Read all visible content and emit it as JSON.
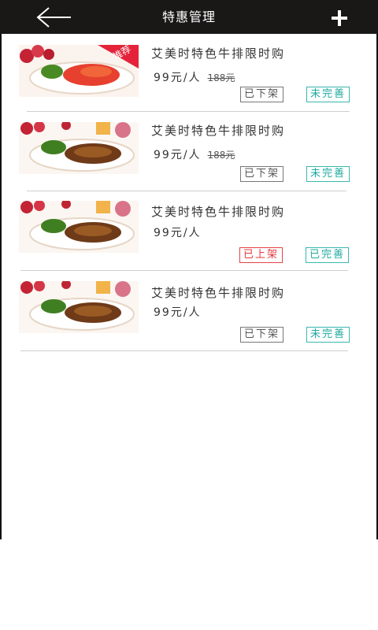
{
  "header": {
    "title": "特惠管理",
    "back_icon": "back-arrow-icon",
    "add_icon": "plus-icon",
    "background": "#1a1717"
  },
  "items": [
    {
      "name": "艾美时特色牛排限时购",
      "price": "99元/人",
      "old_price": "188元",
      "badge": "推荐",
      "shelf_status": "已下架",
      "info_status": "未完善"
    },
    {
      "name": "艾美时特色牛排限时购",
      "price": "99元/人",
      "old_price": "188元",
      "shelf_status": "已下架",
      "info_status": "未完善"
    },
    {
      "name": "艾美时特色牛排限时购",
      "price": "99元/人",
      "shelf_status": "已上架",
      "info_status": "已完善"
    },
    {
      "name": "艾美时特色牛排限时购",
      "price": "99元/人",
      "shelf_status": "已下架",
      "info_status": "未完善"
    }
  ],
  "colors": {
    "status_gray": "#777777",
    "status_teal": "#39b8b0",
    "status_red": "#e34444"
  }
}
